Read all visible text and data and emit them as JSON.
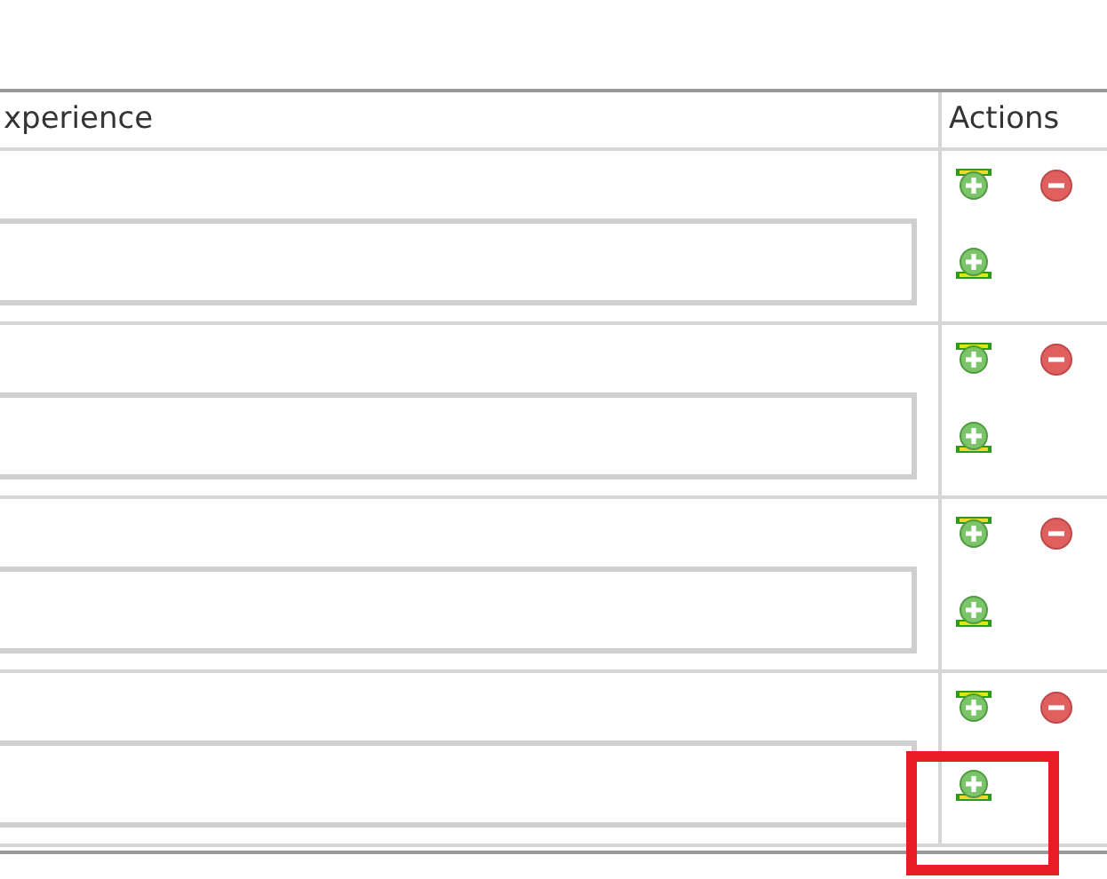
{
  "table": {
    "columns": [
      "xperience",
      "Actions"
    ],
    "rows": [
      {
        "highlighted": false
      },
      {
        "highlighted": false
      },
      {
        "highlighted": false
      },
      {
        "highlighted": true
      }
    ]
  }
}
